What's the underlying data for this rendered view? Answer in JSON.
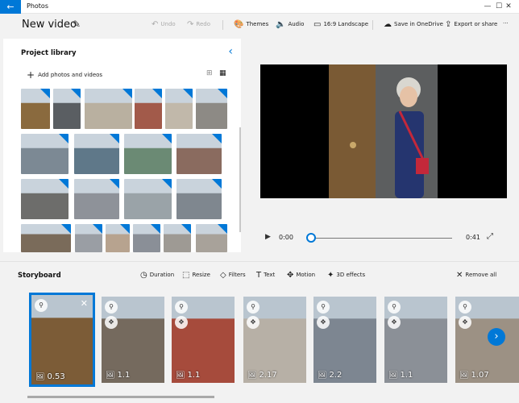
{
  "app": {
    "title": "Photos",
    "back": "←",
    "minimize": "—",
    "maximize": "☐",
    "close": "✕"
  },
  "toolbar": {
    "video_title": "New video",
    "edit_icon": "✎",
    "undo": "Undo",
    "undo_icon": "↶",
    "redo": "Redo",
    "redo_icon": "↷",
    "themes": "Themes",
    "themes_icon": "🎨",
    "audio": "Audio",
    "audio_icon": "🔈",
    "aspect": "16:9 Landscape",
    "aspect_icon": "▭",
    "save_onedrive": "Save in OneDrive",
    "save_icon": "☁",
    "export": "Export or share",
    "export_icon": "⇪",
    "more": "···"
  },
  "library": {
    "title": "Project library",
    "collapse_icon": "‹",
    "add_label": "Add photos and videos",
    "add_icon": "+",
    "grid_small": "⊞",
    "grid_large": "▦",
    "colors": [
      "#8a6a3e",
      "#5a5e62",
      "#b9b0a0",
      "#a25a4a",
      "#c1b8aa",
      "#8d8a85",
      "#7c8994",
      "#5f7889",
      "#6b8a74",
      "#8a6b5f",
      "#6d6d6b",
      "#8e9299",
      "#9aa3a8",
      "#7f878f",
      "#7a6b5a",
      "#9a9ea4",
      "#b7a38f",
      "#8a8f97",
      "#9e9a94",
      "#a8a29a"
    ]
  },
  "player": {
    "play_icon": "▶",
    "time_start": "0:00",
    "time_end": "0:41",
    "fullscreen_icon": "⤢",
    "progress": 0.0,
    "colors": {
      "door": "#7a5a34",
      "wall": "#5c5e5f",
      "dress": "#25356f",
      "bag": "#c3283a",
      "skin": "#e6c2a6",
      "hair": "#d9d7d0"
    }
  },
  "storyboard": {
    "title": "Storyboard",
    "tools": {
      "duration": "Duration",
      "duration_icon": "◷",
      "resize": "Resize",
      "resize_icon": "⬚",
      "filters": "Filters",
      "filters_icon": "◇",
      "text": "Text",
      "text_icon": "T",
      "motion": "Motion",
      "motion_icon": "✥",
      "effects": "3D effects",
      "effects_icon": "✦",
      "remove_all": "Remove all",
      "remove_icon": "✕"
    },
    "clip_icons": {
      "filter": "⚲",
      "motion": "✥",
      "close": "✕",
      "image": "🖼"
    },
    "next_icon": "›",
    "clips": [
      {
        "duration": "0.53",
        "color": "#7c5c37"
      },
      {
        "duration": "1.1",
        "color": "#756a5e"
      },
      {
        "duration": "1.1",
        "color": "#a64b3c"
      },
      {
        "duration": "2.17",
        "color": "#b7b0a6"
      },
      {
        "duration": "2.2",
        "color": "#7d8691"
      },
      {
        "duration": "1.1",
        "color": "#8b9097"
      },
      {
        "duration": "1.07",
        "color": "#9c9184"
      }
    ]
  }
}
